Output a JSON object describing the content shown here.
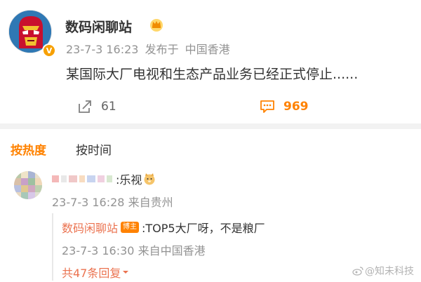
{
  "post": {
    "author": "数码闲聊站",
    "date": "23-7-3 16:23",
    "published_label": "发布于",
    "location": "中国香港",
    "content": "某国际大厂电视和生态产品业务已经正式停止......",
    "verified_icon": "verified-v-badge",
    "level_icon": "crown-icon",
    "shares": "61",
    "comments": "969"
  },
  "sort_tabs": {
    "hot": "按热度",
    "time": "按时间"
  },
  "comment": {
    "text": ":乐视",
    "emoji": "doge-emoji-icon",
    "date": "23-7-3 16:28",
    "location": "来自贵州",
    "reply": {
      "author": "数码闲聊站",
      "badge": "博主",
      "text": ":TOP5大厂呀，不是粮厂",
      "date": "23-7-3 16:30",
      "location": "来自中国香港"
    },
    "more_replies": "共47条回复"
  },
  "watermark": "@知未科技",
  "colors": {
    "accent": "#ff8200",
    "link": "#eb7350",
    "meta": "#939393"
  }
}
